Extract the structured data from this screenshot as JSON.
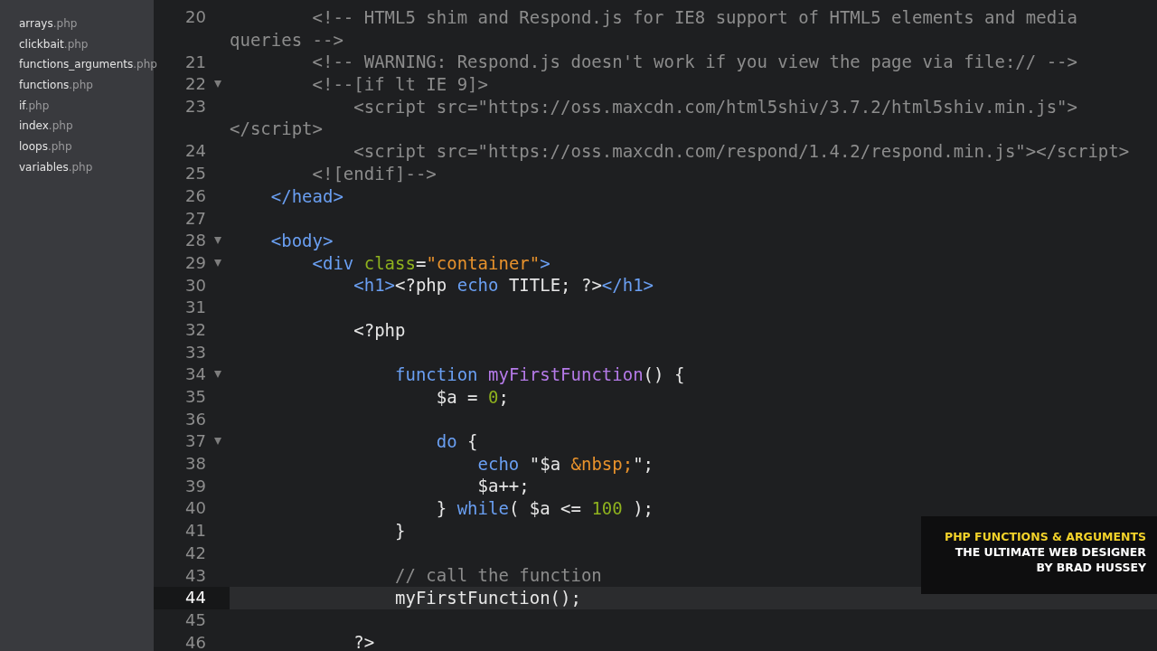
{
  "sidebar": {
    "files": [
      {
        "name": "arrays",
        "ext": ".php",
        "selected": false
      },
      {
        "name": "clickbait",
        "ext": ".php",
        "selected": false
      },
      {
        "name": "functions_arguments",
        "ext": ".php",
        "selected": false
      },
      {
        "name": "functions",
        "ext": ".php",
        "selected": false
      },
      {
        "name": "if",
        "ext": ".php",
        "selected": false
      },
      {
        "name": "index",
        "ext": ".php",
        "selected": false
      },
      {
        "name": "loops",
        "ext": ".php",
        "selected": false
      },
      {
        "name": "variables",
        "ext": ".php",
        "selected": false
      }
    ]
  },
  "editor": {
    "lines": [
      {
        "number": "20",
        "fold": false,
        "current": false,
        "rows": [
          [
            {
              "kind": "comment",
              "text": "        <!-- HTML5 shim and Respond.js for IE8 support of HTML5 elements and media"
            }
          ],
          [
            {
              "kind": "comment",
              "text": "queries -->"
            }
          ]
        ]
      },
      {
        "number": "21",
        "fold": false,
        "current": false,
        "rows": [
          [
            {
              "kind": "comment",
              "text": "        <!-- WARNING: Respond.js doesn't work if you view the page via file:// -->"
            }
          ]
        ]
      },
      {
        "number": "22",
        "fold": true,
        "current": false,
        "rows": [
          [
            {
              "kind": "comment",
              "text": "        <!--[if lt IE 9]>"
            }
          ]
        ]
      },
      {
        "number": "23",
        "fold": false,
        "current": false,
        "rows": [
          [
            {
              "kind": "comment",
              "text": "            <script src=\"https://oss.maxcdn.com/html5shiv/3.7.2/html5shiv.min.js\">"
            }
          ],
          [
            {
              "kind": "comment",
              "text": "</script>"
            }
          ]
        ]
      },
      {
        "number": "24",
        "fold": false,
        "current": false,
        "rows": [
          [
            {
              "kind": "comment",
              "text": "            <script src=\"https://oss.maxcdn.com/respond/1.4.2/respond.min.js\"></script>"
            }
          ]
        ]
      },
      {
        "number": "25",
        "fold": false,
        "current": false,
        "rows": [
          [
            {
              "kind": "comment",
              "text": "        <![endif]-->"
            }
          ]
        ]
      },
      {
        "number": "26",
        "fold": false,
        "current": false,
        "rows": [
          [
            {
              "kind": "plain",
              "text": "    "
            },
            {
              "kind": "tag",
              "text": "</head>"
            }
          ]
        ]
      },
      {
        "number": "27",
        "fold": false,
        "current": false,
        "rows": [
          []
        ]
      },
      {
        "number": "28",
        "fold": true,
        "current": false,
        "rows": [
          [
            {
              "kind": "plain",
              "text": "    "
            },
            {
              "kind": "tag",
              "text": "<body>"
            }
          ]
        ]
      },
      {
        "number": "29",
        "fold": true,
        "current": false,
        "rows": [
          [
            {
              "kind": "plain",
              "text": "        "
            },
            {
              "kind": "tag",
              "text": "<div "
            },
            {
              "kind": "attr",
              "text": "class"
            },
            {
              "kind": "plain",
              "text": "="
            },
            {
              "kind": "string",
              "text": "\"container\""
            },
            {
              "kind": "tag",
              "text": ">"
            }
          ]
        ]
      },
      {
        "number": "30",
        "fold": false,
        "current": false,
        "rows": [
          [
            {
              "kind": "plain",
              "text": "            "
            },
            {
              "kind": "tag",
              "text": "<h1>"
            },
            {
              "kind": "plain",
              "text": "<?php "
            },
            {
              "kind": "keyword",
              "text": "echo"
            },
            {
              "kind": "plain",
              "text": " TITLE; ?>"
            },
            {
              "kind": "tag",
              "text": "</h1>"
            }
          ]
        ]
      },
      {
        "number": "31",
        "fold": false,
        "current": false,
        "rows": [
          []
        ]
      },
      {
        "number": "32",
        "fold": false,
        "current": false,
        "rows": [
          [
            {
              "kind": "plain",
              "text": "            <?php"
            }
          ]
        ]
      },
      {
        "number": "33",
        "fold": false,
        "current": false,
        "rows": [
          []
        ]
      },
      {
        "number": "34",
        "fold": true,
        "current": false,
        "rows": [
          [
            {
              "kind": "plain",
              "text": "                "
            },
            {
              "kind": "keyword",
              "text": "function"
            },
            {
              "kind": "plain",
              "text": " "
            },
            {
              "kind": "func",
              "text": "myFirstFunction"
            },
            {
              "kind": "plain",
              "text": "() {"
            }
          ]
        ]
      },
      {
        "number": "35",
        "fold": false,
        "current": false,
        "rows": [
          [
            {
              "kind": "plain",
              "text": "                    $a = "
            },
            {
              "kind": "number",
              "text": "0"
            },
            {
              "kind": "plain",
              "text": ";"
            }
          ]
        ]
      },
      {
        "number": "36",
        "fold": false,
        "current": false,
        "rows": [
          []
        ]
      },
      {
        "number": "37",
        "fold": true,
        "current": false,
        "rows": [
          [
            {
              "kind": "plain",
              "text": "                    "
            },
            {
              "kind": "keyword",
              "text": "do"
            },
            {
              "kind": "plain",
              "text": " {"
            }
          ]
        ]
      },
      {
        "number": "38",
        "fold": false,
        "current": false,
        "rows": [
          [
            {
              "kind": "plain",
              "text": "                        "
            },
            {
              "kind": "keyword",
              "text": "echo"
            },
            {
              "kind": "plain",
              "text": " \"$a "
            },
            {
              "kind": "string",
              "text": "&nbsp;"
            },
            {
              "kind": "plain",
              "text": "\";"
            }
          ]
        ]
      },
      {
        "number": "39",
        "fold": false,
        "current": false,
        "rows": [
          [
            {
              "kind": "plain",
              "text": "                        $a++;"
            }
          ]
        ]
      },
      {
        "number": "40",
        "fold": false,
        "current": false,
        "rows": [
          [
            {
              "kind": "plain",
              "text": "                    } "
            },
            {
              "kind": "keyword",
              "text": "while"
            },
            {
              "kind": "plain",
              "text": "( $a <= "
            },
            {
              "kind": "number",
              "text": "100"
            },
            {
              "kind": "plain",
              "text": " );"
            }
          ]
        ]
      },
      {
        "number": "41",
        "fold": false,
        "current": false,
        "rows": [
          [
            {
              "kind": "plain",
              "text": "                }"
            }
          ]
        ]
      },
      {
        "number": "42",
        "fold": false,
        "current": false,
        "rows": [
          []
        ]
      },
      {
        "number": "43",
        "fold": false,
        "current": false,
        "rows": [
          [
            {
              "kind": "plain",
              "text": "                "
            },
            {
              "kind": "comment",
              "text": "// call the function"
            }
          ]
        ]
      },
      {
        "number": "44",
        "fold": false,
        "current": true,
        "rows": [
          [
            {
              "kind": "plain",
              "text": "                myFirstFunction();"
            }
          ]
        ]
      },
      {
        "number": "45",
        "fold": false,
        "current": false,
        "rows": [
          []
        ]
      },
      {
        "number": "46",
        "fold": false,
        "current": false,
        "rows": [
          [
            {
              "kind": "plain",
              "text": "            ?>"
            }
          ]
        ]
      }
    ]
  },
  "caption": {
    "title": "PHP FUNCTIONS & ARGUMENTS",
    "lines": [
      "THE ULTIMATE WEB DESIGNER",
      "BY BRAD HUSSEY"
    ]
  }
}
